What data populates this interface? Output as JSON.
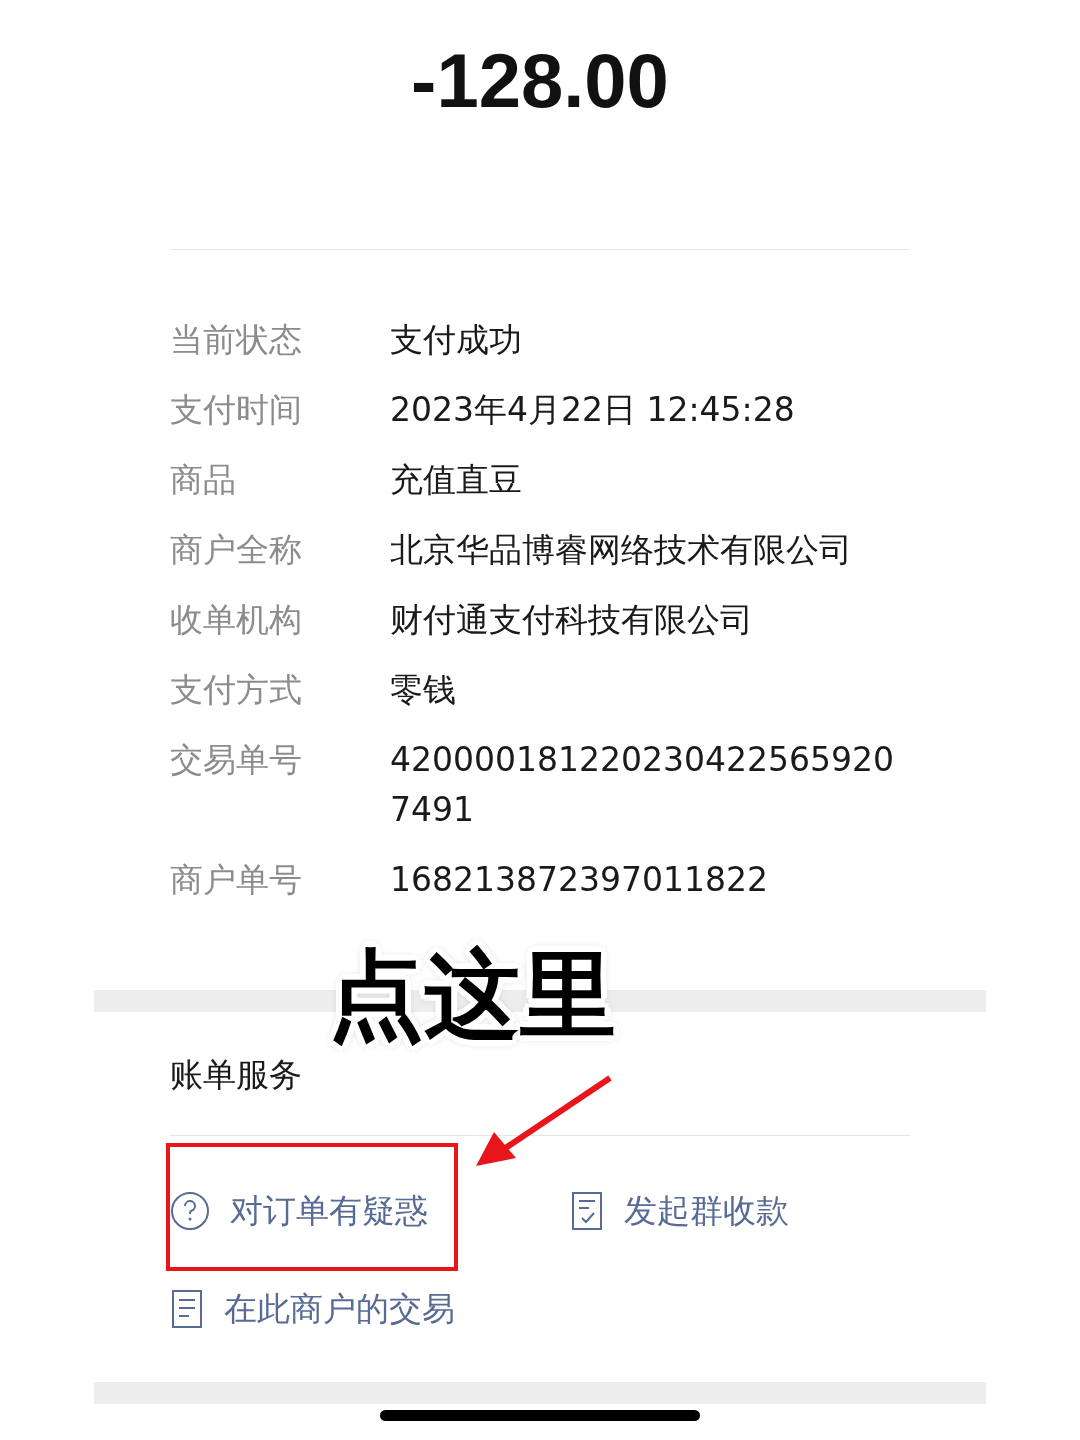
{
  "amount": "-128.00",
  "details": [
    {
      "label": "当前状态",
      "value": "支付成功"
    },
    {
      "label": "支付时间",
      "value": "2023年4月22日 12:45:28"
    },
    {
      "label": "商品",
      "value": "充值直豆"
    },
    {
      "label": "商户全称",
      "value": "北京华品博睿网络技术有限公司"
    },
    {
      "label": "收单机构",
      "value": "财付通支付科技有限公司"
    },
    {
      "label": "支付方式",
      "value": "零钱"
    },
    {
      "label": "交易单号",
      "value": "4200001812202304225659207491"
    },
    {
      "label": "商户单号",
      "value": "168213872397011822"
    }
  ],
  "bill_services": {
    "title": "账单服务",
    "items": [
      {
        "label": "对订单有疑惑",
        "kind": "question"
      },
      {
        "label": "发起群收款",
        "kind": "collect"
      },
      {
        "label": "在此商户的交易",
        "kind": "list"
      }
    ]
  },
  "callout": {
    "text": "点这里"
  }
}
